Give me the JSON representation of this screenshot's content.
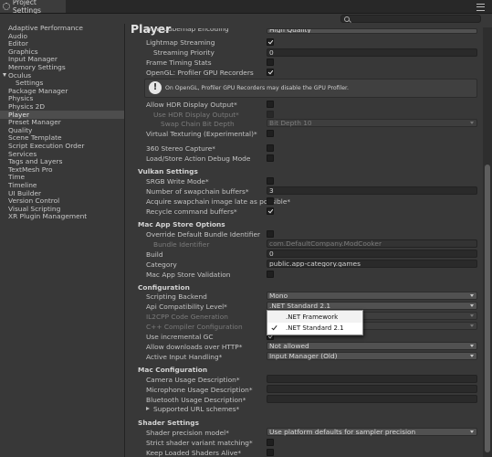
{
  "window": {
    "title": "Project Settings"
  },
  "sidebar": {
    "items": [
      {
        "label": "Adaptive Performance"
      },
      {
        "label": "Audio"
      },
      {
        "label": "Editor"
      },
      {
        "label": "Graphics"
      },
      {
        "label": "Input Manager"
      },
      {
        "label": "Memory Settings"
      },
      {
        "label": "Oculus"
      },
      {
        "label": "Settings"
      },
      {
        "label": "Package Manager"
      },
      {
        "label": "Physics"
      },
      {
        "label": "Physics 2D"
      },
      {
        "label": "Player"
      },
      {
        "label": "Preset Manager"
      },
      {
        "label": "Quality"
      },
      {
        "label": "Scene Template"
      },
      {
        "label": "Script Execution Order"
      },
      {
        "label": "Services"
      },
      {
        "label": "Tags and Layers"
      },
      {
        "label": "TextMesh Pro"
      },
      {
        "label": "Time"
      },
      {
        "label": "Timeline"
      },
      {
        "label": "UI Builder"
      },
      {
        "label": "Version Control"
      },
      {
        "label": "Visual Scripting"
      },
      {
        "label": "XR Plugin Management"
      }
    ]
  },
  "main": {
    "title": "Player",
    "partial_top_label": "HDR Cubemap Encoding",
    "partial_top_value": "High Quality",
    "rows": {
      "lightmap_streaming": "Lightmap Streaming",
      "streaming_priority": "Streaming Priority",
      "streaming_priority_value": "0",
      "frame_timing_stats": "Frame Timing Stats",
      "opengl_profiler": "OpenGL: Profiler GPU Recorders",
      "help_text": "On OpenGL, Profiler GPU Recorders may disable the GPU Profiler.",
      "allow_hdr": "Allow HDR Display Output*",
      "use_hdr": "Use HDR Display Output*",
      "swap_chain_bit_depth": "Swap Chain Bit Depth",
      "swap_chain_bit_depth_value": "Bit Depth 10",
      "virtual_texturing": "Virtual Texturing (Experimental)*",
      "stereo_360": "360 Stereo Capture*",
      "load_store_debug": "Load/Store Action Debug Mode",
      "vulkan_header": "Vulkan Settings",
      "srgb_write": "SRGB Write Mode*",
      "swapchain_buffers": "Number of swapchain buffers*",
      "swapchain_buffers_value": "3",
      "acquire_swapchain": "Acquire swapchain image late as possible*",
      "recycle_buffers": "Recycle command buffers*",
      "mac_store_header": "Mac App Store Options",
      "override_bundle": "Override Default Bundle Identifier",
      "bundle_identifier": "Bundle Identifier",
      "bundle_identifier_value": "com.DefaultCompany.ModCooker",
      "build": "Build",
      "build_value": "0",
      "category": "Category",
      "category_value": "public.app-category.games",
      "mac_store_validation": "Mac App Store Validation",
      "configuration_header": "Configuration",
      "scripting_backend": "Scripting Backend",
      "scripting_backend_value": "Mono",
      "api_compat": "Api Compatibility Level*",
      "api_compat_value": ".NET Standard 2.1",
      "il2cpp_gen": "IL2CPP Code Generation",
      "cpp_compiler": "C++ Compiler Configuration",
      "incremental_gc": "Use incremental GC",
      "allow_http": "Allow downloads over HTTP*",
      "allow_http_value": "Not allowed",
      "active_input": "Active Input Handling*",
      "active_input_value": "Input Manager (Old)",
      "mac_config_header": "Mac Configuration",
      "camera_usage": "Camera Usage Description*",
      "mic_usage": "Microphone Usage Description*",
      "bluetooth_usage": "Bluetooth Usage Description*",
      "supported_url": "Supported URL schemes*",
      "shader_header": "Shader Settings",
      "shader_precision": "Shader precision model*",
      "shader_precision_value": "Use platform defaults for sampler precision",
      "strict_variant": "Strict shader variant matching*",
      "keep_loaded": "Keep Loaded Shaders Alive*"
    }
  },
  "popup": {
    "options": [
      {
        "label": ".NET Framework",
        "selected": false
      },
      {
        "label": ".NET Standard 2.1",
        "selected": true
      }
    ]
  }
}
